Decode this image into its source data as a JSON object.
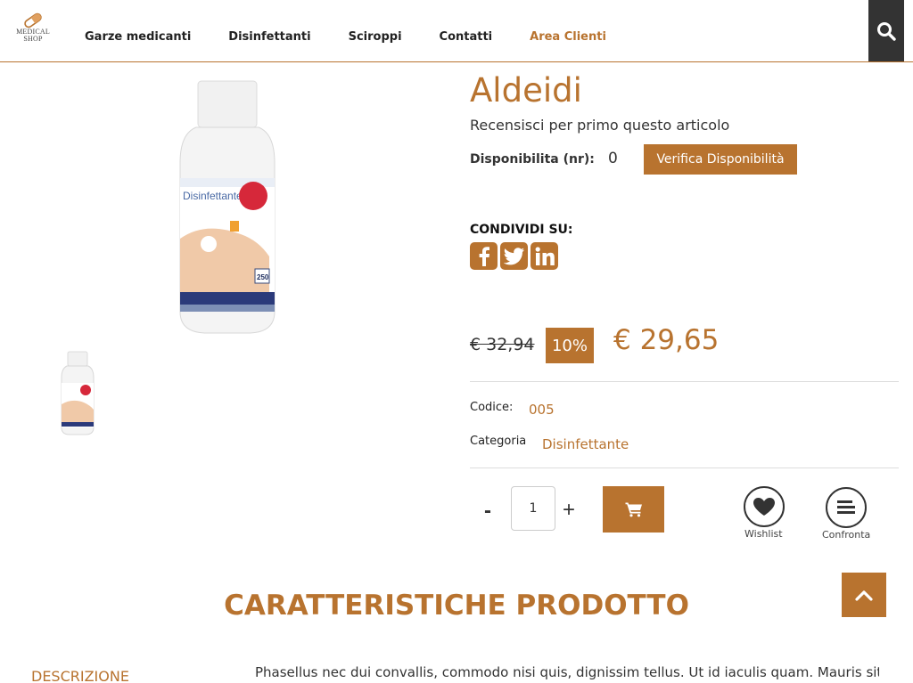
{
  "brand": {
    "logo_text_line1": "MEDICAL",
    "logo_text_line2": "SHOP",
    "accent_color": "#b8732f"
  },
  "nav": {
    "items": [
      {
        "label": "Garze medicanti"
      },
      {
        "label": "Disinfettanti"
      },
      {
        "label": "Sciroppi"
      },
      {
        "label": "Contatti"
      },
      {
        "label": "Area Clienti"
      }
    ],
    "search_icon": "search-icon"
  },
  "product": {
    "title": "Aldeidi",
    "review_link": "Recensisci per primo questo articolo",
    "availability_label": "Disponibilita (nr):",
    "availability_value": "0",
    "verify_button": "Verifica Disponibilità",
    "image_label": "Disinfettante",
    "image_badge": "250",
    "share_label": "CONDIVIDI SU:",
    "social": [
      "facebook-icon",
      "twitter-icon",
      "linkedin-icon"
    ],
    "old_price": "€ 32,94",
    "discount": "10%",
    "price": "€ 29,65",
    "code_label": "Codice:",
    "code_value": "005",
    "category_label": "Categoria",
    "category_value": "Disinfettante",
    "quantity": "1",
    "minus_label": "-",
    "plus_label": "+",
    "wishlist_label": "Wishlist",
    "compare_label": "Confronta"
  },
  "section": {
    "title": "CARATTERISTICHE PRODOTTO",
    "tab_description": "DESCRIZIONE",
    "description_text": "Phasellus nec dui convallis, commodo nisi quis, dignissim tellus. Ut id iaculis quam. Mauris sit"
  }
}
